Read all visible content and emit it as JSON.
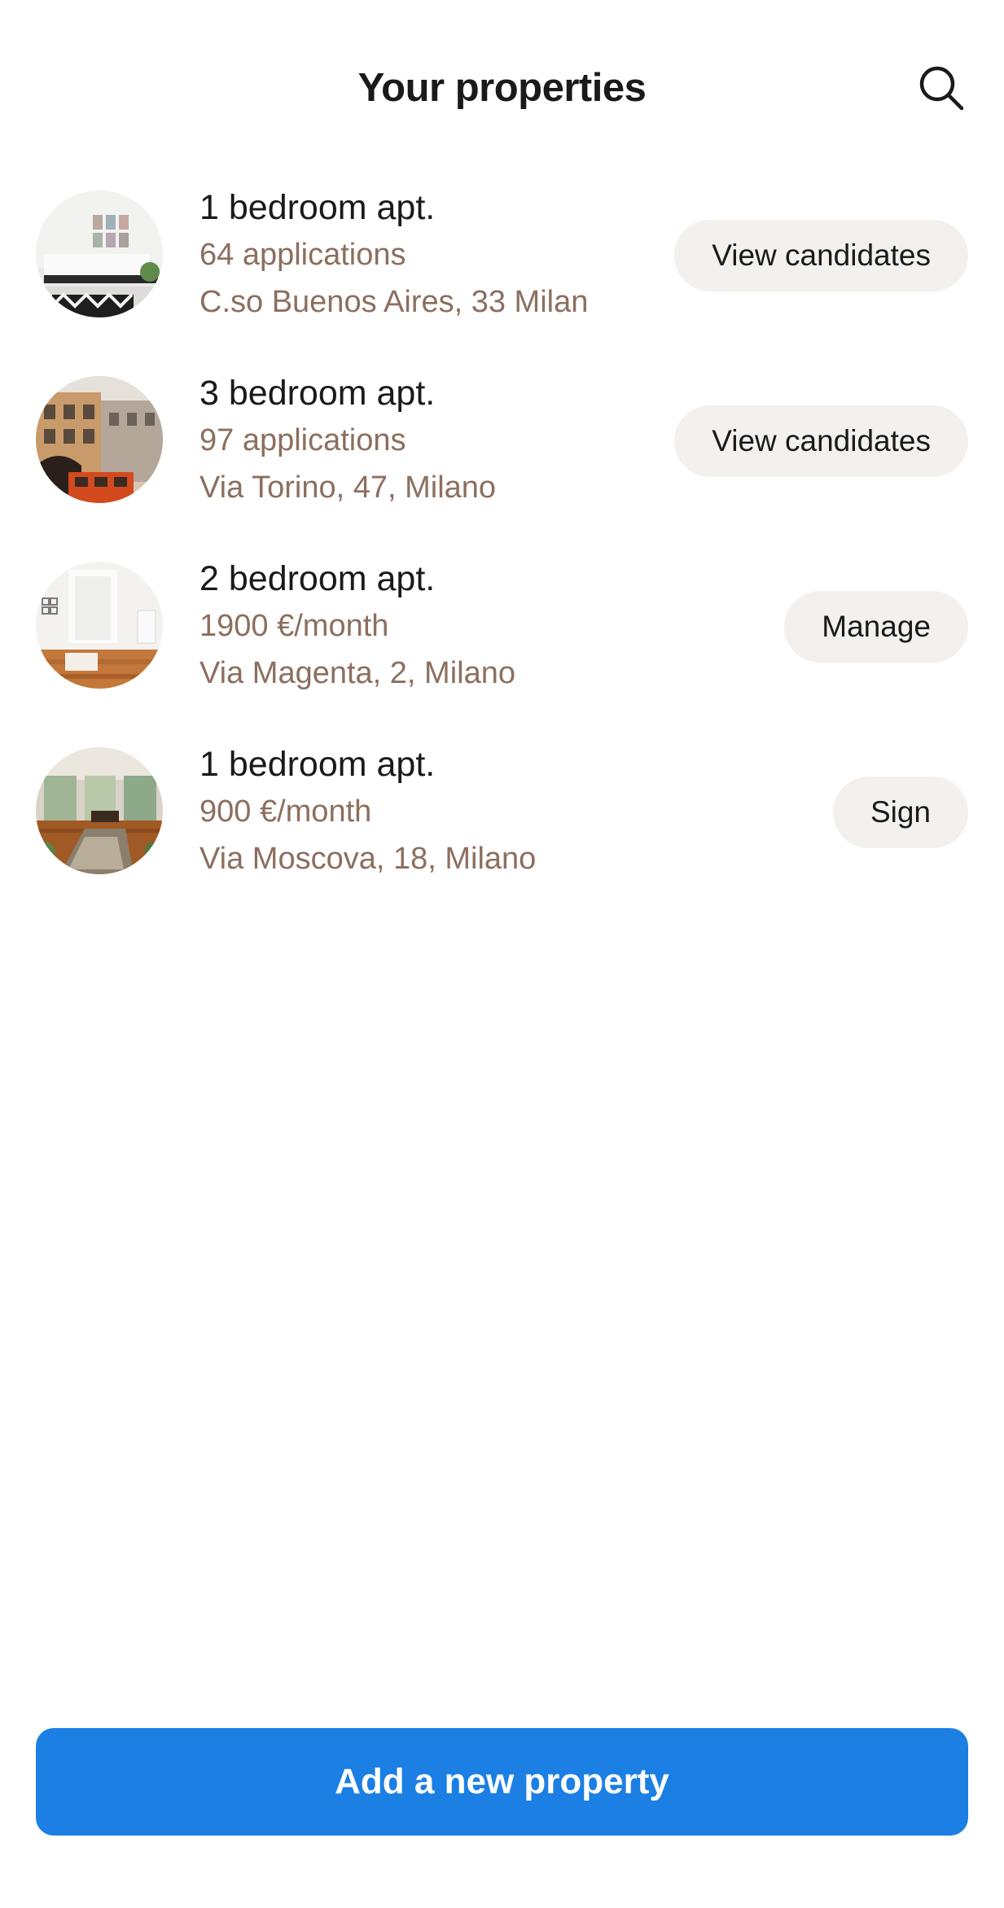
{
  "header": {
    "title": "Your properties",
    "search_icon": "search-icon"
  },
  "properties": [
    {
      "title": "1 bedroom apt.",
      "detail": "64 applications",
      "address": "C.so Buenos Aires, 33 Milan",
      "action": "View candidates",
      "photo": "bedroom-interior-photo"
    },
    {
      "title": "3 bedroom apt.",
      "detail": "97 applications",
      "address": "Via Torino, 47, Milano",
      "action": "View candidates",
      "photo": "street-building-photo"
    },
    {
      "title": "2 bedroom apt.",
      "detail": "1900 €/month",
      "address": "Via Magenta, 2, Milano",
      "action": "Manage",
      "photo": "living-room-photo"
    },
    {
      "title": "1 bedroom apt.",
      "detail": "900 €/month",
      "address": "Via Moscova, 18, Milano",
      "action": "Sign",
      "photo": "dining-room-photo"
    }
  ],
  "footer": {
    "add_label": "Add a new property"
  },
  "colors": {
    "primary": "#1b7fe3",
    "secondary_text": "#8c6f5f",
    "pill_bg": "#f3f0ed",
    "text": "#1a1a1a"
  }
}
